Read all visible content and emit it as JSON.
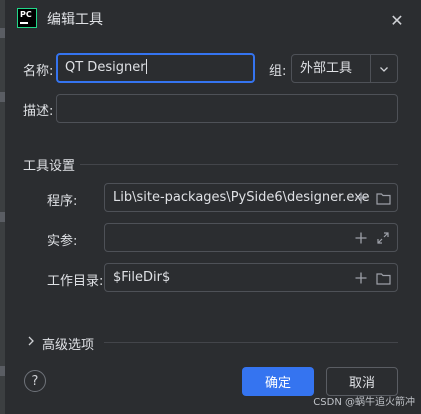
{
  "dialog": {
    "title": "编辑工具",
    "close_glyph": "✕",
    "app_icon_text": "PC"
  },
  "form": {
    "name_label": "名称:",
    "name_value": "QT Designer",
    "group_label": "组:",
    "group_value": "外部工具",
    "description_label": "描述:",
    "description_value": ""
  },
  "tool_settings": {
    "section_title": "工具设置",
    "program_label": "程序:",
    "program_value": "Lib\\site-packages\\PySide6\\designer.exe",
    "args_label": "实参:",
    "args_value": "",
    "workdir_label": "工作目录:",
    "workdir_value": "$FileDir$"
  },
  "advanced": {
    "label": "高级选项",
    "chevron_glyph": "›"
  },
  "buttons": {
    "help_glyph": "?",
    "ok": "确定",
    "cancel": "取消"
  },
  "watermark": "CSDN @蜗牛追火箭冲",
  "colors": {
    "background": "#2b2d30",
    "accent": "#3574f0",
    "border": "#4e5157",
    "text": "#dfe1e5"
  },
  "icons": [
    "pycharm-app-icon",
    "close-icon",
    "chevron-down-icon",
    "plus-icon",
    "folder-icon",
    "expand-icon",
    "chevron-right-icon",
    "help-icon"
  ]
}
